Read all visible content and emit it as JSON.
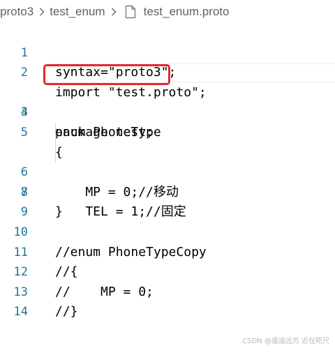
{
  "breadcrumb": {
    "folder": "proto3",
    "subfolder": "test_enum",
    "file": "test_enum.proto",
    "separator_icon": "chevron-right-icon",
    "file_icon": "file-icon"
  },
  "editor": {
    "lines": [
      {
        "number": "1",
        "text": "syntax=\"proto3\";"
      },
      {
        "number": "2",
        "text": "import \"test.proto\";"
      },
      {
        "number": "3",
        "text": "package test;"
      },
      {
        "number": "4",
        "text": "enum PhoneType"
      },
      {
        "number": "5",
        "text": "{"
      },
      {
        "number": "6",
        "text": "    MP = 0;//移动"
      },
      {
        "number": "7",
        "text": "    TEL = 1;//固定"
      },
      {
        "number": "8",
        "text": "}"
      },
      {
        "number": "9",
        "text": ""
      },
      {
        "number": "10",
        "text": "//enum PhoneTypeCopy"
      },
      {
        "number": "11",
        "text": "//{"
      },
      {
        "number": "12",
        "text": "//    MP = 0;"
      },
      {
        "number": "13",
        "text": "//}"
      },
      {
        "number": "14",
        "text": ""
      }
    ],
    "highlight_color": "#e8262d",
    "line_number_color": "#237893"
  },
  "watermark": "CSDN @遥遥远方 近在咫尺"
}
